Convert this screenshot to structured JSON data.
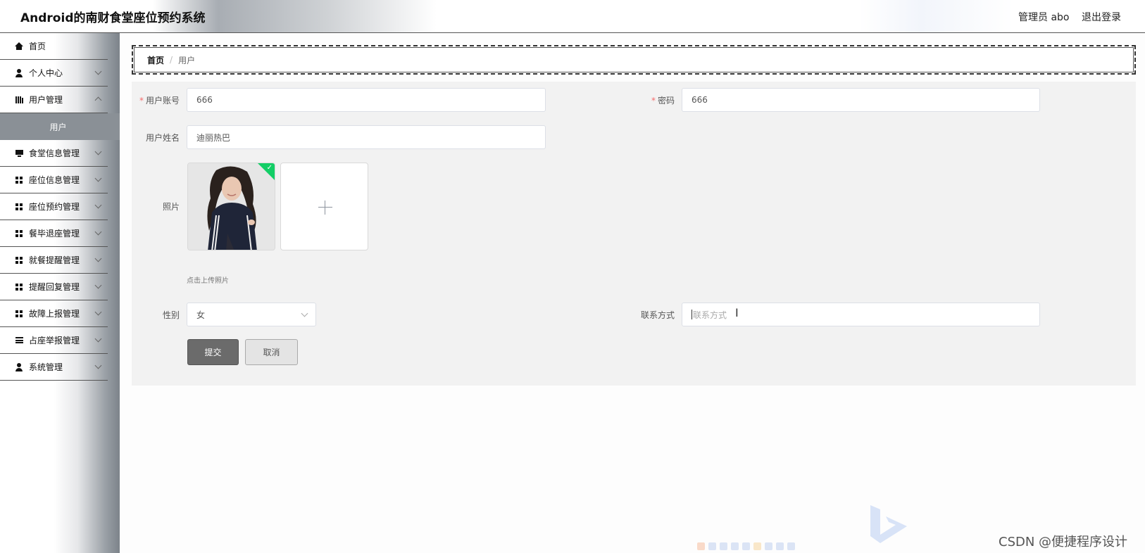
{
  "header": {
    "title": "Android的南财食堂座位预约系统",
    "user": "管理员 abo",
    "logout": "退出登录"
  },
  "sidebar": {
    "items": [
      {
        "label": "首页",
        "icon": "home-icon"
      },
      {
        "label": "个人中心",
        "icon": "user-icon"
      },
      {
        "label": "用户管理",
        "icon": "books-icon"
      },
      {
        "label": "食堂信息管理",
        "icon": "monitor-icon"
      },
      {
        "label": "座位信息管理",
        "icon": "grid-icon"
      },
      {
        "label": "座位预约管理",
        "icon": "grid-icon"
      },
      {
        "label": "餐毕退座管理",
        "icon": "grid-icon"
      },
      {
        "label": "就餐提醒管理",
        "icon": "grid-icon"
      },
      {
        "label": "提醒回复管理",
        "icon": "grid-icon"
      },
      {
        "label": "故障上报管理",
        "icon": "grid-icon"
      },
      {
        "label": "占座举报管理",
        "icon": "list-icon"
      },
      {
        "label": "系统管理",
        "icon": "user-icon"
      }
    ],
    "active_submenu": "用户"
  },
  "breadcrumb": {
    "home": "首页",
    "separator": "/",
    "current": "用户"
  },
  "form": {
    "account_label": "用户账号",
    "account_value": "666",
    "password_label": "密码",
    "password_value": "666",
    "name_label": "用户姓名",
    "name_value": "迪丽热巴",
    "photo_label": "照片",
    "upload_tip": "点击上传照片",
    "gender_label": "性别",
    "gender_value": "女",
    "contact_label": "联系方式",
    "contact_placeholder": "联系方式",
    "submit": "提交",
    "cancel": "取消",
    "required_mark": "*"
  },
  "watermark": "CSDN @便捷程序设计",
  "colors": {
    "success": "#13ce66",
    "required": "#f56c6c",
    "submit_bg": "#6b6b6b"
  }
}
